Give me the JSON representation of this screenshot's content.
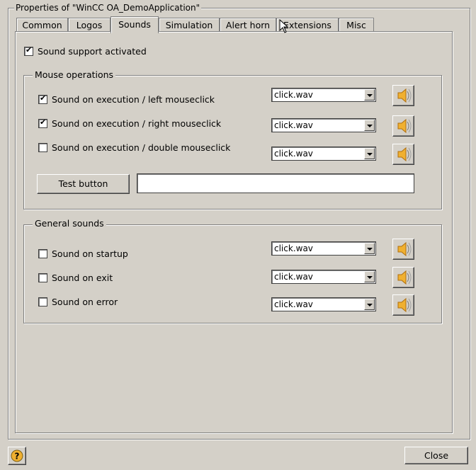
{
  "dialog": {
    "frame_title": "Properties of \"WinCC OA_DemoApplication\"",
    "close_label": "Close",
    "help_icon": "help-question-icon"
  },
  "tabs": [
    {
      "label": "Common"
    },
    {
      "label": "Logos"
    },
    {
      "label": "Sounds",
      "active": true
    },
    {
      "label": "Simulation"
    },
    {
      "label": "Alert horn"
    },
    {
      "label": "Extensions"
    },
    {
      "label": "Misc"
    }
  ],
  "sounds": {
    "support_label": "Sound support activated",
    "support_checked": true,
    "mouse_group_title": "Mouse operations",
    "mouse_rows": [
      {
        "label": "Sound on execution / left mouseclick",
        "checked": true,
        "file": "click.wav"
      },
      {
        "label": "Sound on execution / right mouseclick",
        "checked": true,
        "file": "click.wav"
      },
      {
        "label": "Sound on execution / double mouseclick",
        "checked": false,
        "file": "click.wav"
      }
    ],
    "test_button_label": "Test button",
    "test_field_value": "",
    "general_group_title": "General sounds",
    "general_rows": [
      {
        "label": "Sound on startup",
        "checked": false,
        "file": "click.wav"
      },
      {
        "label": "Sound on exit",
        "checked": false,
        "file": "click.wav"
      },
      {
        "label": "Sound on error",
        "checked": false,
        "file": "click.wav"
      }
    ]
  },
  "icons": {
    "speaker": "speaker-icon",
    "checkmark": "✔"
  },
  "colors": {
    "face": "#d4d0c8",
    "shadow": "#808080",
    "highlight": "#ffffff",
    "speaker": "#f0b030"
  }
}
